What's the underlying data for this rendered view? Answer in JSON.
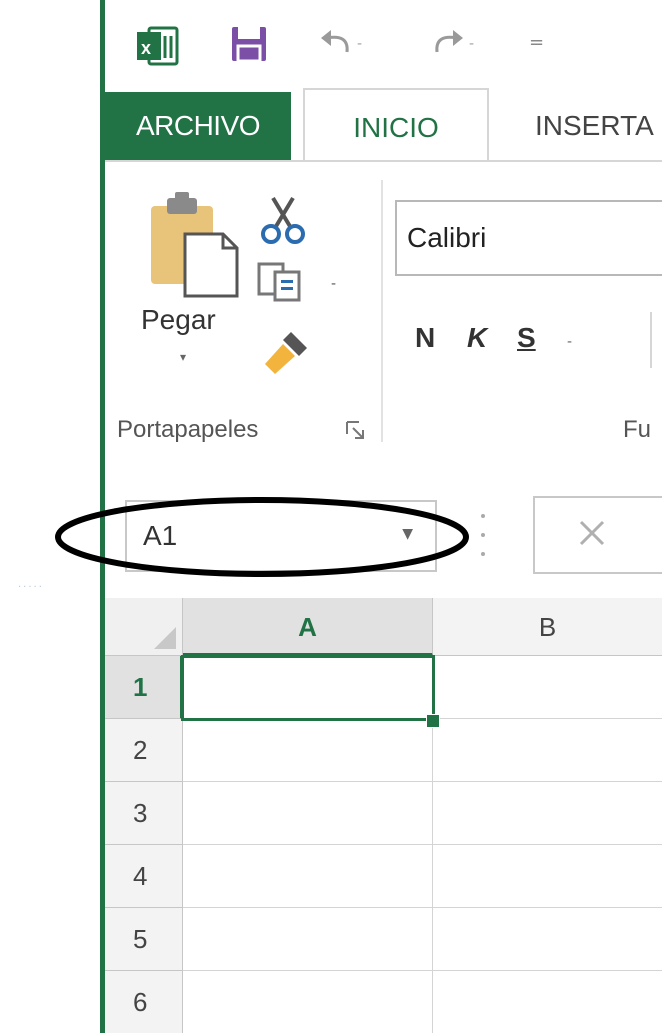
{
  "quick_access": {
    "icons": [
      "excel-logo",
      "save-icon",
      "undo-icon",
      "redo-icon",
      "customize-icon"
    ],
    "dropdown_glyph": "-",
    "customize_glyph": "="
  },
  "tabs": {
    "archivo": "ARCHIVO",
    "inicio": "INICIO",
    "insertar": "INSERTA"
  },
  "ribbon": {
    "clipboard": {
      "paste_label": "Pegar",
      "group_label": "Portapapeles",
      "icons": [
        "paste-icon",
        "cut-icon",
        "copy-icon",
        "format-painter-icon",
        "dialog-launcher-icon"
      ]
    },
    "font": {
      "font_name": "Calibri",
      "bold": "N",
      "italic": "K",
      "underline": "S",
      "group_label": "Fu"
    }
  },
  "formula_bar": {
    "name_box_value": "A1",
    "cancel_icon": "cancel-x-icon"
  },
  "sheet": {
    "columns": [
      "A",
      "B"
    ],
    "rows": [
      "1",
      "2",
      "3",
      "4",
      "5",
      "6"
    ],
    "active_cell": "A1"
  },
  "colors": {
    "excel_green": "#217346",
    "annotation": "#000000"
  }
}
